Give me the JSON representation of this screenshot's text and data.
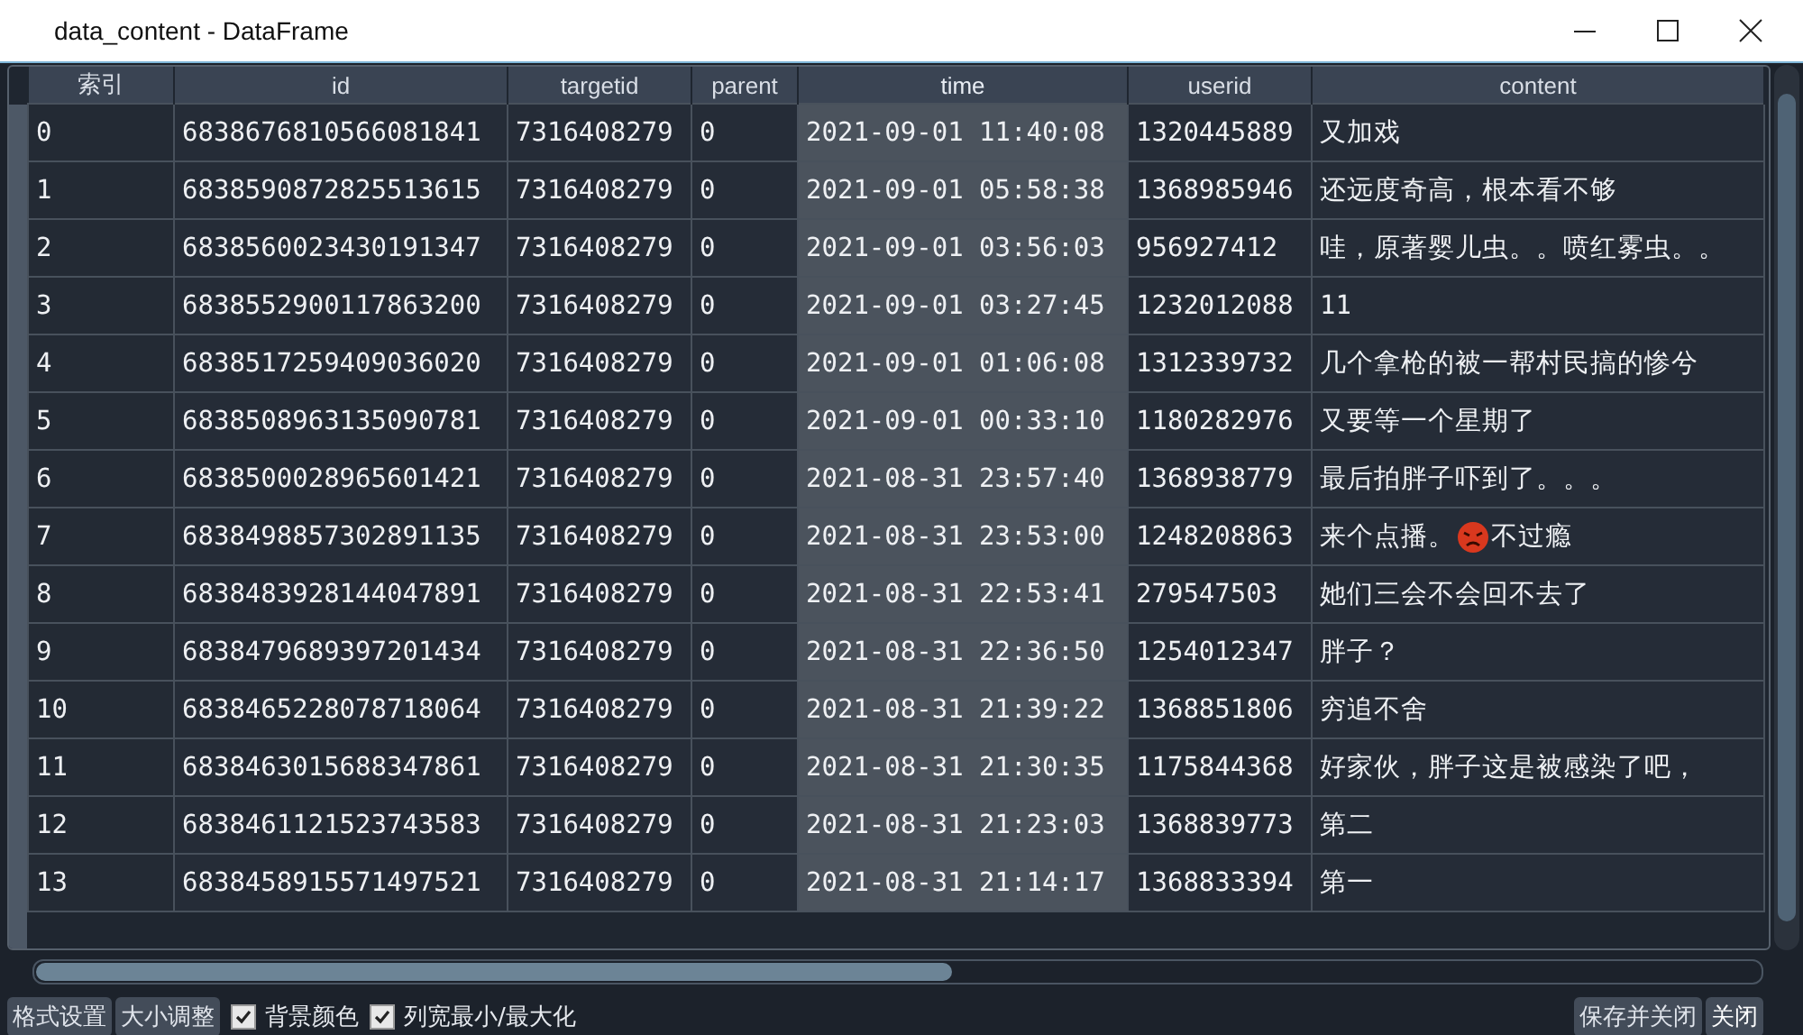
{
  "window": {
    "title": "data_content - DataFrame"
  },
  "table": {
    "columns": [
      {
        "label": "索引",
        "selected": false
      },
      {
        "label": "id",
        "selected": false
      },
      {
        "label": "targetid",
        "selected": false
      },
      {
        "label": "parent",
        "selected": false
      },
      {
        "label": "time",
        "selected": true
      },
      {
        "label": "userid",
        "selected": false
      },
      {
        "label": "content",
        "selected": false
      }
    ],
    "rows": [
      [
        "0",
        "6838676810566081841",
        "7316408279",
        "0",
        "2021-09-01 11:40:08",
        "1320445889",
        "又加戏"
      ],
      [
        "1",
        "6838590872825513615",
        "7316408279",
        "0",
        "2021-09-01 05:58:38",
        "1368985946",
        "还远度奇高，根本看不够"
      ],
      [
        "2",
        "6838560023430191347",
        "7316408279",
        "0",
        "2021-09-01 03:56:03",
        "956927412",
        "哇，原著婴儿虫。。喷红雾虫。。"
      ],
      [
        "3",
        "6838552900117863200",
        "7316408279",
        "0",
        "2021-09-01 03:27:45",
        "1232012088",
        "11"
      ],
      [
        "4",
        "6838517259409036020",
        "7316408279",
        "0",
        "2021-09-01 01:06:08",
        "1312339732",
        "几个拿枪的被一帮村民搞的惨兮"
      ],
      [
        "5",
        "6838508963135090781",
        "7316408279",
        "0",
        "2021-09-01 00:33:10",
        "1180282976",
        "又要等一个星期了"
      ],
      [
        "6",
        "6838500028965601421",
        "7316408279",
        "0",
        "2021-08-31 23:57:40",
        "1368938779",
        "最后拍胖子吓到了。。。"
      ],
      [
        "7",
        "6838498857302891135",
        "7316408279",
        "0",
        "2021-08-31 23:53:00",
        "1248208863",
        [
          "来个点播。",
          {
            "kind": "angry-emoji"
          },
          "不过瘾"
        ]
      ],
      [
        "8",
        "6838483928144047891",
        "7316408279",
        "0",
        "2021-08-31 22:53:41",
        "279547503",
        "她们三会不会回不去了"
      ],
      [
        "9",
        "6838479689397201434",
        "7316408279",
        "0",
        "2021-08-31 22:36:50",
        "1254012347",
        "胖子？"
      ],
      [
        "10",
        "6838465228078718064",
        "7316408279",
        "0",
        "2021-08-31 21:39:22",
        "1368851806",
        "穷追不舍"
      ],
      [
        "11",
        "6838463015688347861",
        "7316408279",
        "0",
        "2021-08-31 21:30:35",
        "1175844368",
        "好家伙，胖子这是被感染了吧，"
      ],
      [
        "12",
        "6838461121523743583",
        "7316408279",
        "0",
        "2021-08-31 21:23:03",
        "1368839773",
        "第二"
      ],
      [
        "13",
        "6838458915571497521",
        "7316408279",
        "0",
        "2021-08-31 21:14:17",
        "1368833394",
        "第一"
      ]
    ]
  },
  "toolbar": {
    "buttons": [
      "格式设置",
      "大小调整"
    ],
    "checkboxes": [
      {
        "label": "背景颜色",
        "checked": true
      },
      {
        "label": "列宽最小/最大化",
        "checked": true
      }
    ],
    "actions": [
      "保存并关闭",
      "关闭"
    ]
  }
}
